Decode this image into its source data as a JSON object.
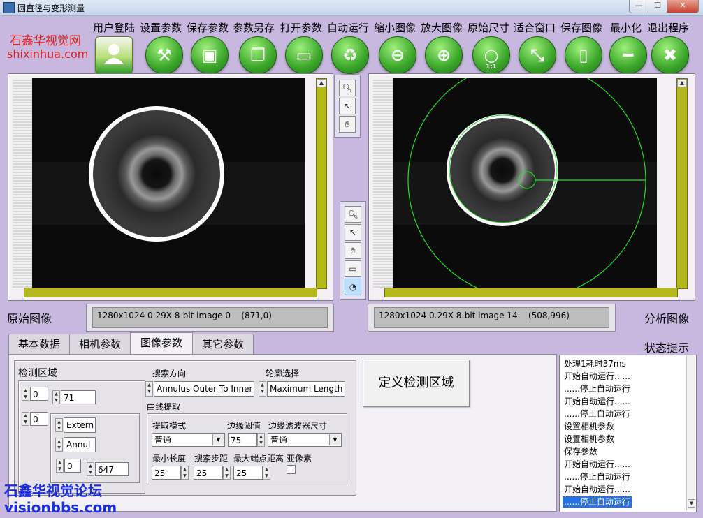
{
  "window": {
    "title": "圆直径与变形测量",
    "min": "—",
    "max": "☐",
    "close": "✕"
  },
  "watermark": {
    "top_cn": "石鑫华视觉网",
    "top_url": "shixinhua.com",
    "bottom_cn": "石鑫华视觉论坛",
    "bottom_url": "visionbbs.com"
  },
  "toolbar": [
    {
      "label": "用户登陆",
      "icon": "user-icon"
    },
    {
      "label": "设置参数",
      "icon": "tools-icon"
    },
    {
      "label": "保存参数",
      "icon": "save-icon"
    },
    {
      "label": "参数另存",
      "icon": "copy-icon"
    },
    {
      "label": "打开参数",
      "icon": "folder-icon"
    },
    {
      "label": "自动运行",
      "icon": "recycle-icon"
    },
    {
      "label": "缩小图像",
      "icon": "zoom-out-icon"
    },
    {
      "label": "放大图像",
      "icon": "zoom-in-icon"
    },
    {
      "label": "原始尺寸",
      "icon": "zoom-1to1-icon",
      "badge": "1:1"
    },
    {
      "label": "适合窗口",
      "icon": "zoom-fit-icon"
    },
    {
      "label": "保存图像",
      "icon": "document-icon"
    },
    {
      "label": "最小化",
      "icon": "minus-icon"
    },
    {
      "label": "退出程序",
      "icon": "close-icon"
    }
  ],
  "left_view": {
    "caption": "原始图像",
    "info": "1280x1024 0.29X 8-bit image 0    (871,0)"
  },
  "right_view": {
    "caption": "分析图像",
    "info": "1280x1024 0.29X 8-bit image 14    (508,996)"
  },
  "tabs": [
    "基本数据",
    "相机参数",
    "图像参数",
    "其它参数"
  ],
  "active_tab": 2,
  "roi": {
    "title": "检测区域",
    "val_a": "0",
    "val_b": "71",
    "val_c": "0",
    "sel_1": "Extern",
    "sel_2": "Annul",
    "val_d": "0",
    "val_e": "647"
  },
  "search": {
    "direction_label": "搜索方向",
    "direction_value": "Annulus Outer To Inner",
    "contour_label": "轮廓选择",
    "contour_value": "Maximum Length",
    "curve_label": "曲线提取"
  },
  "curve": {
    "mode_label": "提取模式",
    "mode_value": "普通",
    "threshold_label": "边缘阈值",
    "threshold_value": "75",
    "filter_label": "边缘滤波器尺寸",
    "filter_value": "普通",
    "minlen_label": "最小长度",
    "minlen_value": "25",
    "step_label": "搜索步距",
    "step_value": "25",
    "maxdist_label": "最大端点距离",
    "maxdist_value": "25",
    "subpixel_label": "亚像素"
  },
  "define_button": "定义检测区域",
  "status": {
    "title": "状态提示",
    "items": [
      "处理1耗时37ms",
      "开始自动运行......",
      "......停止自动运行",
      "开始自动运行......",
      "......停止自动运行",
      "设置相机参数",
      "设置相机参数",
      "保存参数",
      "开始自动运行......",
      "......停止自动运行",
      "开始自动运行......",
      "......停止自动运行"
    ],
    "selected": 11
  }
}
